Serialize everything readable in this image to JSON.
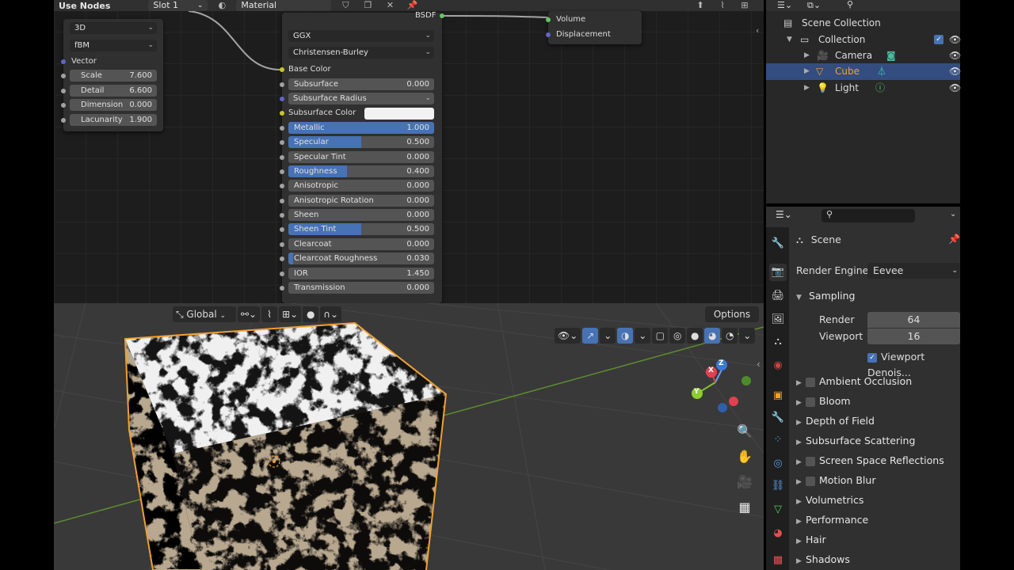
{
  "node_editor": {
    "header": {
      "use_nodes": "Use Nodes",
      "slot": "Slot 1",
      "material": "Material"
    },
    "noise_node": {
      "dimension_mode": "3D",
      "type": "fBM",
      "vector_label": "Vector",
      "fields": [
        {
          "label": "Scale",
          "value": "7.600"
        },
        {
          "label": "Detail",
          "value": "6.600"
        },
        {
          "label": "Dimension",
          "value": "0.000"
        },
        {
          "label": "Lacunarity",
          "value": "1.900"
        }
      ]
    },
    "bsdf_node": {
      "output_label": "BSDF",
      "distribution": "GGX",
      "subsurface_method": "Christensen-Burley",
      "base_color_label": "Base Color",
      "subsurface": {
        "label": "Subsurface",
        "value": "0.000"
      },
      "subsurface_radius": "Subsurface Radius",
      "subsurface_color": "Subsurface Color",
      "fields": [
        {
          "label": "Metallic",
          "value": "1.000",
          "fill": 1.0
        },
        {
          "label": "Specular",
          "value": "0.500",
          "fill": 0.5
        },
        {
          "label": "Specular Tint",
          "value": "0.000",
          "fill": 0
        },
        {
          "label": "Roughness",
          "value": "0.400",
          "fill": 0.4
        },
        {
          "label": "Anisotropic",
          "value": "0.000",
          "fill": 0
        },
        {
          "label": "Anisotropic Rotation",
          "value": "0.000",
          "fill": 0
        },
        {
          "label": "Sheen",
          "value": "0.000",
          "fill": 0
        },
        {
          "label": "Sheen Tint",
          "value": "0.500",
          "fill": 0.5
        },
        {
          "label": "Clearcoat",
          "value": "0.000",
          "fill": 0
        },
        {
          "label": "Clearcoat Roughness",
          "value": "0.030",
          "fill": 0.03
        },
        {
          "label": "IOR",
          "value": "1.450",
          "fill": 0
        },
        {
          "label": "Transmission",
          "value": "0.000",
          "fill": 0
        }
      ]
    },
    "output_node": {
      "volume": "Volume",
      "displacement": "Displacement"
    }
  },
  "viewport": {
    "transform_orientation": "Global",
    "options_label": "Options",
    "gizmo": {
      "x": "X",
      "y": "Y",
      "z": "Z"
    }
  },
  "outliner": {
    "scene_collection": "Scene Collection",
    "collection": "Collection",
    "items": [
      {
        "label": "Camera"
      },
      {
        "label": "Cube"
      },
      {
        "label": "Light"
      }
    ]
  },
  "properties": {
    "scene_label": "Scene",
    "render_engine_label": "Render Engine",
    "render_engine_value": "Eevee",
    "sampling_label": "Sampling",
    "render_label": "Render",
    "render_value": "64",
    "viewport_label": "Viewport",
    "viewport_value": "16",
    "viewport_denoise": "Viewport Denois...",
    "panels": [
      {
        "label": "Ambient Occlusion"
      },
      {
        "label": "Bloom"
      },
      {
        "label": "Depth of Field"
      },
      {
        "label": "Subsurface Scattering"
      },
      {
        "label": "Screen Space Reflections"
      },
      {
        "label": "Motion Blur"
      },
      {
        "label": "Volumetrics"
      },
      {
        "label": "Performance"
      },
      {
        "label": "Hair"
      },
      {
        "label": "Shadows"
      }
    ]
  },
  "colors": {
    "accent": "#4772b3",
    "selection_outline": "#f0a030",
    "socket_gray": "#a1a1a1",
    "socket_yellow": "#c7c729",
    "socket_purple": "#6363c7",
    "socket_green": "#63c763"
  }
}
